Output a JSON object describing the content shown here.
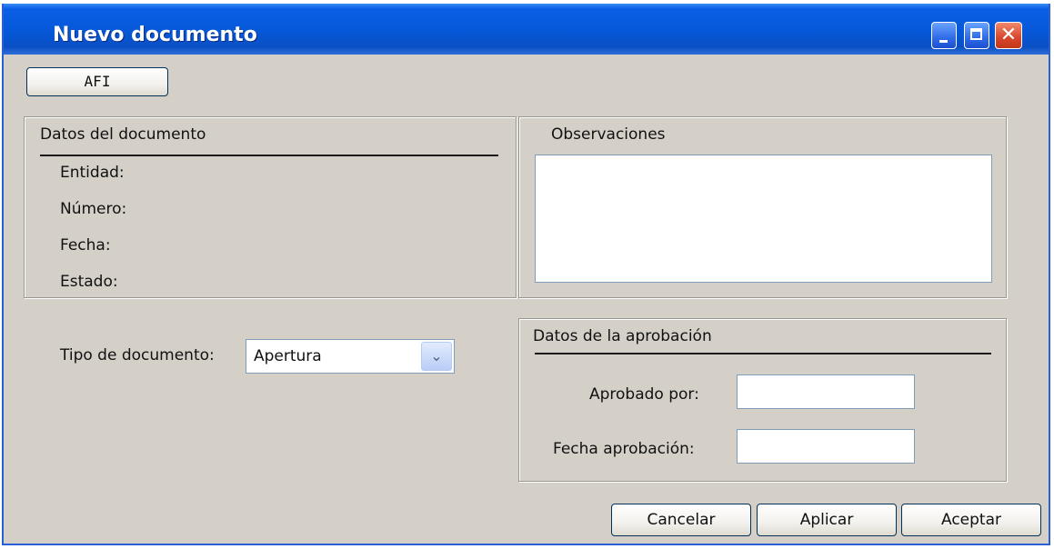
{
  "window": {
    "title": "Nuevo documento",
    "controls": {
      "minimize_icon": "minimize-icon",
      "maximize_icon": "maximize-icon",
      "close_icon": "close-icon",
      "close_glyph": "✕"
    }
  },
  "toolbar": {
    "afi_label": "AFI"
  },
  "document_data": {
    "title": "Datos del documento",
    "fields": {
      "entidad": "Entidad:",
      "numero": "Número:",
      "fecha": "Fecha:",
      "estado": "Estado:"
    }
  },
  "observations": {
    "title": "Observaciones",
    "value": ""
  },
  "document_type": {
    "label": "Tipo de documento:",
    "selected": "Apertura",
    "arrow_glyph": "⌄"
  },
  "approval": {
    "title": "Datos de la aprobación",
    "approved_by_label": "Aprobado por:",
    "approved_by_value": "",
    "approval_date_label": "Fecha aprobación:",
    "approval_date_value": ""
  },
  "footer": {
    "cancel_label": "Cancelar",
    "apply_label": "Aplicar",
    "accept_label": "Aceptar"
  },
  "colors": {
    "titlebar": "#0658d8",
    "window_bg": "#d4d0c8",
    "input_border": "#7f9db9"
  }
}
